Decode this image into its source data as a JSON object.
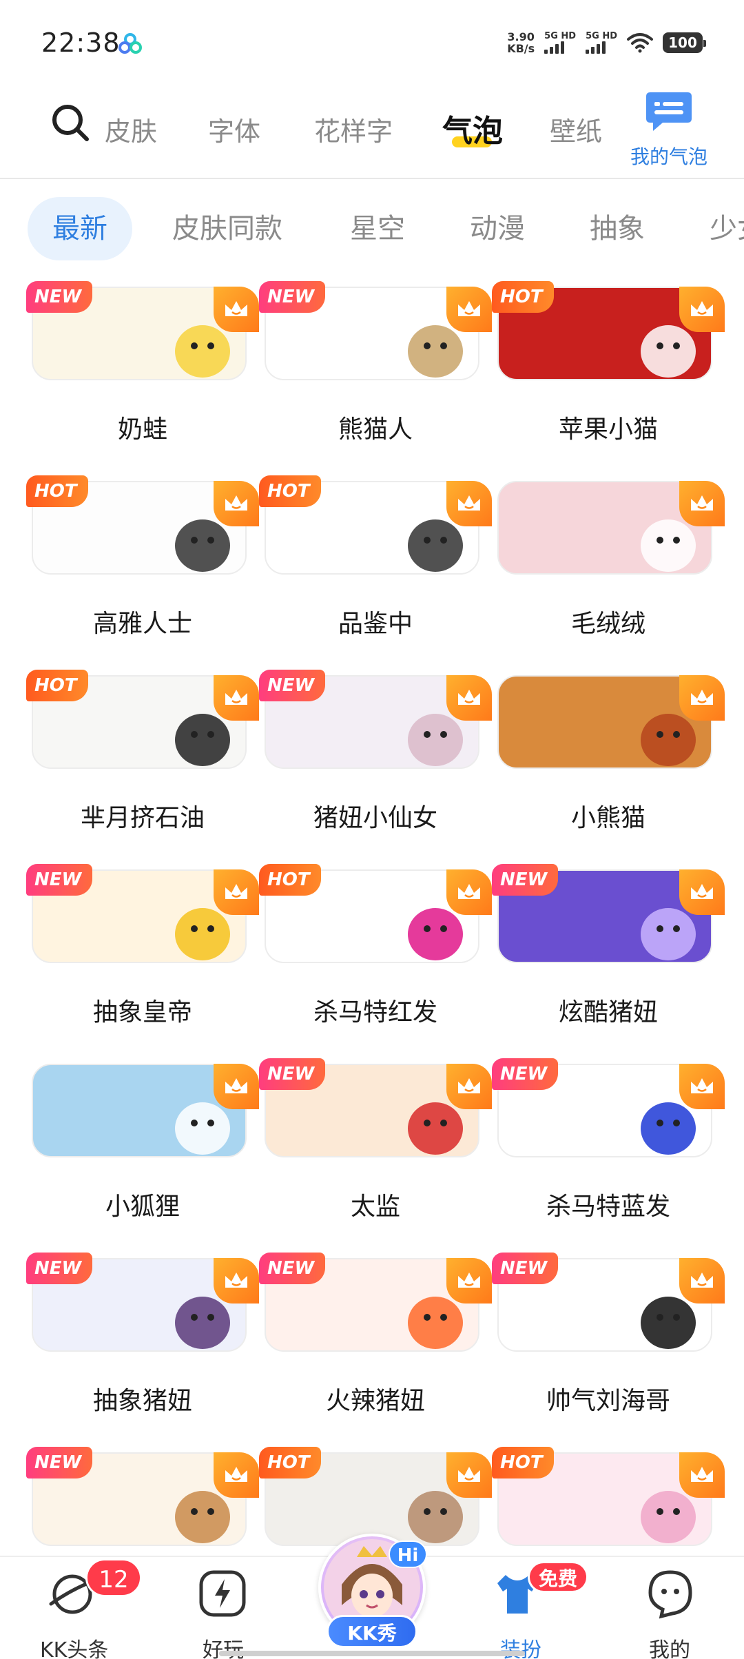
{
  "status_bar": {
    "time": "22:38",
    "net_speed_value": "3.90",
    "net_speed_unit": "KB/s",
    "sim1_label": "5G HD",
    "sim2_label": "5G HD",
    "battery": "100"
  },
  "top_tabs": {
    "items": [
      {
        "label": "皮肤"
      },
      {
        "label": "字体"
      },
      {
        "label": "花样字"
      },
      {
        "label": "气泡"
      },
      {
        "label": "壁纸"
      }
    ],
    "active_index": 3,
    "my_bubble_label": "我的气泡"
  },
  "categories": {
    "items": [
      {
        "label": "最新"
      },
      {
        "label": "皮肤同款"
      },
      {
        "label": "星空"
      },
      {
        "label": "动漫"
      },
      {
        "label": "抽象"
      },
      {
        "label": "少女"
      }
    ],
    "active_index": 0
  },
  "bubbles": [
    {
      "name": "奶蛙",
      "badge": "NEW",
      "bg": "#fbf6e6",
      "accent": "#f7d23c"
    },
    {
      "name": "熊猫人",
      "badge": "NEW",
      "bg": "#ffffff",
      "accent": "#c9a46a"
    },
    {
      "name": "苹果小猫",
      "badge": "HOT",
      "bg": "#c8201e",
      "accent": "#ffffff"
    },
    {
      "name": "高雅人士",
      "badge": "HOT",
      "bg": "#fdfdfd",
      "accent": "#333333"
    },
    {
      "name": "品鉴中",
      "badge": "HOT",
      "bg": "#ffffff",
      "accent": "#333333"
    },
    {
      "name": "毛绒绒",
      "badge": "",
      "bg": "#f6d6da",
      "accent": "#ffffff"
    },
    {
      "name": "芈月挤石油",
      "badge": "HOT",
      "bg": "#f7f7f5",
      "accent": "#222222"
    },
    {
      "name": "猪妞小仙女",
      "badge": "NEW",
      "bg": "#f3eef5",
      "accent": "#d9b9c8"
    },
    {
      "name": "小熊猫",
      "badge": "",
      "bg": "#d98a3c",
      "accent": "#b5441c"
    },
    {
      "name": "抽象皇帝",
      "badge": "NEW",
      "bg": "#fff4e0",
      "accent": "#f6c21d"
    },
    {
      "name": "杀马特红发",
      "badge": "HOT",
      "bg": "#ffffff",
      "accent": "#e0188a"
    },
    {
      "name": "炫酷猪妞",
      "badge": "NEW",
      "bg": "#6a4fd0",
      "accent": "#c9b3ff"
    },
    {
      "name": "小狐狸",
      "badge": "",
      "bg": "#a9d5f0",
      "accent": "#ffffff"
    },
    {
      "name": "太监",
      "badge": "NEW",
      "bg": "#fce9d6",
      "accent": "#d82a2a"
    },
    {
      "name": "杀马特蓝发",
      "badge": "NEW",
      "bg": "#ffffff",
      "accent": "#1e3ad6"
    },
    {
      "name": "抽象猪妞",
      "badge": "NEW",
      "bg": "#eef0fb",
      "accent": "#5a3a7a"
    },
    {
      "name": "火辣猪妞",
      "badge": "NEW",
      "bg": "#fff1ec",
      "accent": "#ff6a2a"
    },
    {
      "name": "帅气刘海哥",
      "badge": "NEW",
      "bg": "#ffffff",
      "accent": "#111111"
    },
    {
      "name": "",
      "badge": "NEW",
      "bg": "#fcf4e8",
      "accent": "#c98a4a"
    },
    {
      "name": "",
      "badge": "HOT",
      "bg": "#f1efeb",
      "accent": "#b58a6a"
    },
    {
      "name": "",
      "badge": "HOT",
      "bg": "#fde9f0",
      "accent": "#f0a6c8"
    }
  ],
  "bottom_nav": {
    "items": [
      {
        "label": "KK头条",
        "active": false
      },
      {
        "label": "好玩",
        "active": false
      },
      {
        "label": "KK秀",
        "active": false
      },
      {
        "label": "装扮",
        "active": true
      },
      {
        "label": "我的",
        "active": false
      }
    ],
    "news_badge_count": "12",
    "free_badge": "免费",
    "hi_badge": "Hi"
  },
  "colors": {
    "accent_blue": "#2f7fe0",
    "new_badge": "#ff3d7f",
    "hot_badge": "#ff5a1f",
    "crown": "#ff9a24"
  }
}
